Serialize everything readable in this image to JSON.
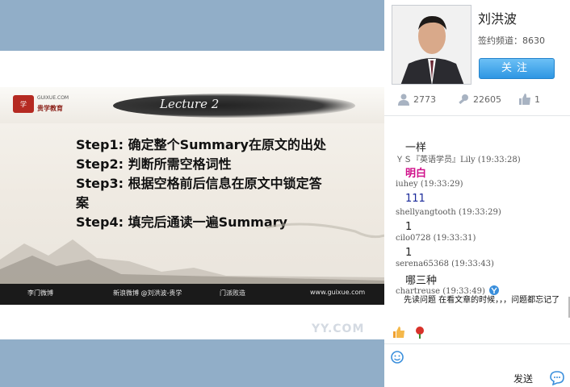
{
  "slide": {
    "logo_badge": "学",
    "logo_top": "GUIXUE.COM",
    "logo_bottom": "贵学教育",
    "lecture": "Lecture 2",
    "steps": [
      {
        "label": "Step1:",
        "text": " 确定整个Summary在原文的出处"
      },
      {
        "label": "Step2:",
        "text": " 判断所需空格词性"
      },
      {
        "label": "Step3:",
        "text": " 根据空格前后信息在原文中锁定答案"
      },
      {
        "label": "Step4:",
        "text": " 填完后通读一遍Summary"
      }
    ],
    "footer": [
      "李门微博",
      "新浪微博 @刘洪波-贵学",
      "门派败造",
      "www.guixue.com"
    ]
  },
  "watermark": "YY.COM",
  "profile": {
    "name": "刘洪波",
    "channel": "签约频道：8630",
    "follow_label": "关注",
    "stats": [
      {
        "icon": "person-icon",
        "value": "2773"
      },
      {
        "icon": "wrench-icon",
        "value": "22605"
      },
      {
        "icon": "thumbs-up-icon",
        "value": "1"
      }
    ]
  },
  "chat": {
    "messages": [
      {
        "text": "一样",
        "color": "#222222"
      },
      {
        "user": "ＹＳ『英语学员』Lily",
        "time": "(19:33:28)",
        "text": "明白",
        "color": "#d0108a"
      },
      {
        "user": "iuhey",
        "time": "(19:33:29)",
        "text": "111",
        "color": "#1a2a9a"
      },
      {
        "user": "shellyangtooth",
        "time": "(19:33:29)",
        "text": "1",
        "color": "#222222"
      },
      {
        "user": "cilo0728",
        "time": "(19:33:31)",
        "text": "1",
        "color": "#222222"
      },
      {
        "user": "serena65368",
        "time": "(19:33:43)",
        "text": "哪三种",
        "color": "#222222"
      },
      {
        "user": "chartreuse",
        "time": "(19:33:49)"
      }
    ],
    "last_message": "先读问题 在看文章的时候，，，问题都忘记了",
    "send_label": "发送"
  },
  "colors": {
    "bg_blue": "#91aec8",
    "follow_blue": "#2e96e3"
  }
}
